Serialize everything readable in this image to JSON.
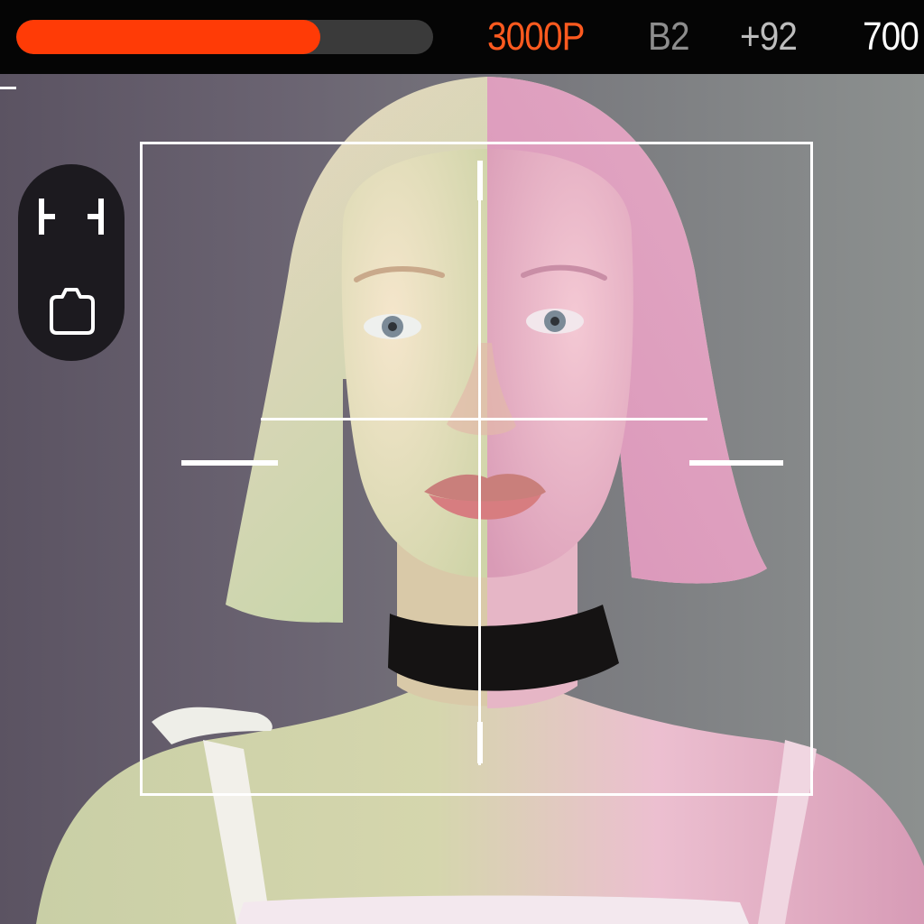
{
  "status_bar": {
    "battery_level_percent": 73,
    "battery_fill_color": "#ff3b06",
    "resolution": "3000P",
    "bitrate": "B2",
    "exposure": "+92",
    "iso": "700",
    "resolution_color": "#ff5a1f"
  },
  "controls": {
    "focus_frame_icon": "focus-bracket-icon",
    "camera_mode_icon": "camera-body-icon"
  }
}
